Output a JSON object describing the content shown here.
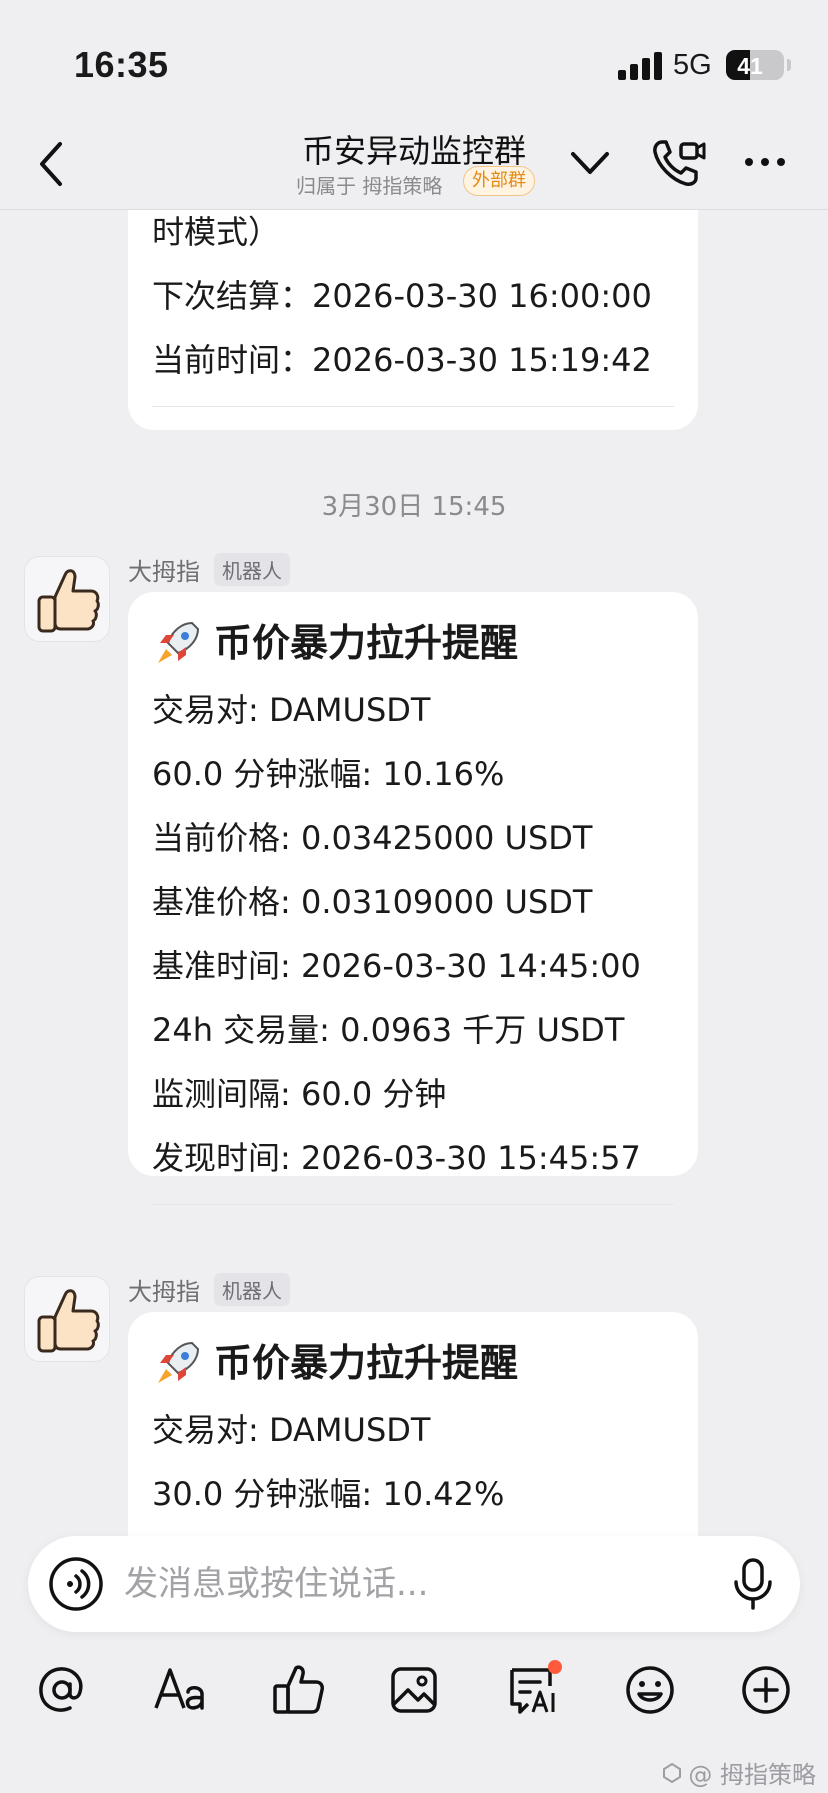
{
  "status_bar": {
    "time": "16:35",
    "network": "5G",
    "battery": "41"
  },
  "header": {
    "title": "币安异动监控群",
    "subtitle": "归属于 拇指策略",
    "badge": "外部群"
  },
  "messages": {
    "prev": {
      "line0": "时模式）",
      "line1": "下次结算：2026-03-30 16:00:00",
      "line2": "当前时间：2026-03-30 15:19:42"
    },
    "time_separator": "3月30日 15:45",
    "msg1": {
      "sender": "大拇指",
      "tag": "机器人",
      "title": "币价暴力拉升提醒",
      "lines": [
        "交易对: DAMUSDT",
        "60.0 分钟涨幅: 10.16%",
        "当前价格: 0.03425000 USDT",
        "基准价格: 0.03109000 USDT",
        "基准时间: 2026-03-30 14:45:00",
        "24h 交易量: 0.0963 千万 USDT",
        "监测间隔: 60.0 分钟",
        "发现时间: 2026-03-30 15:45:57"
      ]
    },
    "msg2": {
      "sender": "大拇指",
      "tag": "机器人",
      "title": "币价暴力拉升提醒",
      "lines": [
        "交易对: DAMUSDT",
        "30.0 分钟涨幅: 10.42%"
      ]
    }
  },
  "input": {
    "placeholder": "发消息或按住说话..."
  },
  "toolbar": {
    "items": [
      "mention-icon",
      "text-format-icon",
      "thumbs-up-icon",
      "image-icon",
      "ai-icon",
      "emoji-icon",
      "plus-icon"
    ]
  },
  "watermark": "@ 拇指策略",
  "colors": {
    "background": "#EFEFF1",
    "badge_orange": "#E58A17",
    "notification_dot": "#FF5A3C"
  }
}
